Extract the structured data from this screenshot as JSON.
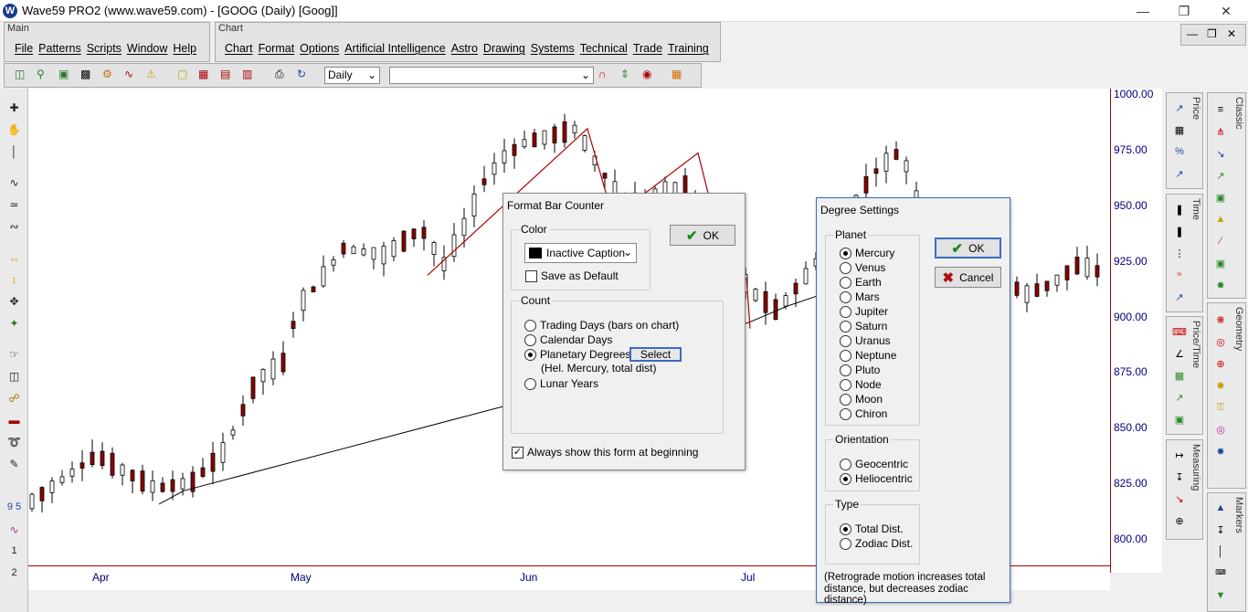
{
  "window": {
    "title": "Wave59 PRO2 (www.wave59.com) - [GOOG (Daily) [Goog]]",
    "app_icon": "W"
  },
  "main_panel": {
    "title": "Main",
    "menu": [
      "File",
      "Patterns",
      "Scripts",
      "Window",
      "Help"
    ]
  },
  "chart_panel": {
    "title": "Chart",
    "menu": [
      "Chart",
      "Format",
      "Options",
      "Artificial Intelligence",
      "Astro",
      "Drawing",
      "Systems",
      "Technical",
      "Trade",
      "Training"
    ]
  },
  "toolbar": {
    "timeframe": "Daily",
    "symbol": ""
  },
  "chart_data": {
    "type": "candlestick",
    "y_ticks": [
      "1000.00",
      "975.00",
      "950.00",
      "925.00",
      "900.00",
      "875.00",
      "850.00",
      "825.00",
      "800.00"
    ],
    "x_ticks": [
      "Apr",
      "May",
      "Jun",
      "Jul"
    ],
    "ylim": [
      788,
      1003
    ],
    "colors": {
      "up": "#000000",
      "down": "#8b0000",
      "zigzag": "#b00000",
      "counter": "#000000",
      "axis": "#000080"
    }
  },
  "side_panels": {
    "price": "Price",
    "time": "Time",
    "price_time": "Price/Time",
    "measuring": "Measuring",
    "classic": "Classic",
    "geometry": "Geometry",
    "markers": "Markers"
  },
  "left_tools": {
    "nums1": "9 5",
    "nums2": "1",
    "nums3": "2"
  },
  "format_bar_counter": {
    "title": "Format Bar Counter",
    "color_group": "Color",
    "color_value": "Inactive Caption",
    "save_default": "Save as Default",
    "ok": "OK",
    "count_group": "Count",
    "options": [
      "Trading Days (bars on chart)",
      "Calendar Days",
      "Planetary Degrees",
      "Lunar Years"
    ],
    "selected": 2,
    "select_button": "Select",
    "planet_note": "(Hel.  Mercury, total dist)",
    "always_show": "Always show this form at beginning"
  },
  "degree_settings": {
    "title": "Degree Settings",
    "planet_group": "Planet",
    "planets": [
      "Mercury",
      "Venus",
      "Earth",
      "Mars",
      "Jupiter",
      "Saturn",
      "Uranus",
      "Neptune",
      "Pluto",
      "Node",
      "Moon",
      "Chiron"
    ],
    "selected_planet": 0,
    "ok": "OK",
    "cancel": "Cancel",
    "orientation_group": "Orientation",
    "orientations": [
      "Geocentric",
      "Heliocentric"
    ],
    "selected_orientation": 1,
    "type_group": "Type",
    "types": [
      "Total Dist.",
      "Zodiac Dist."
    ],
    "selected_type": 0,
    "note_line1": "(Retrograde motion increases total",
    "note_line2": "distance, but decreases zodiac distance)"
  }
}
